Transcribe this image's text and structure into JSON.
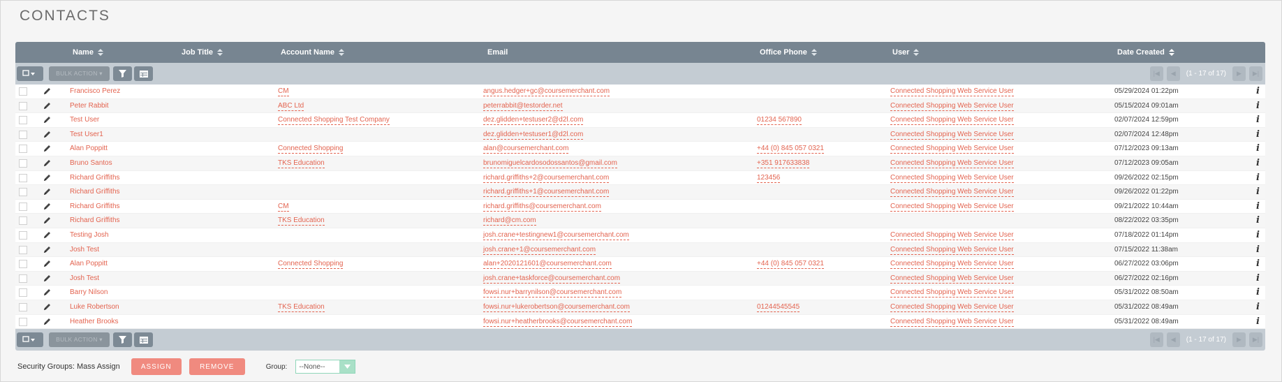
{
  "page": {
    "title": "CONTACTS"
  },
  "columns": {
    "name": "Name",
    "job_title": "Job Title",
    "account_name": "Account Name",
    "email": "Email",
    "office_phone": "Office Phone",
    "user": "User",
    "date_created": "Date Created"
  },
  "toolbar": {
    "bulk_action_label": "BULK ACTION ▾",
    "pagination_text": "(1 - 17 of 17)"
  },
  "rows": [
    {
      "name": "Francisco Perez",
      "account": "CM",
      "email": "angus.hedger+gc@coursemerchant.com",
      "phone": "",
      "user": "Connected Shopping Web Service User",
      "date": "05/29/2024 01:22pm"
    },
    {
      "name": "Peter Rabbit",
      "account": "ABC Ltd",
      "email": "peterrabbit@testorder.net",
      "phone": "",
      "user": "Connected Shopping Web Service User",
      "date": "05/15/2024 09:01am"
    },
    {
      "name": "Test User",
      "account": "Connected Shopping Test Company",
      "email": "dez.glidden+testuser2@d2l.com",
      "phone": "01234 567890",
      "user": "Connected Shopping Web Service User",
      "date": "02/07/2024 12:59pm"
    },
    {
      "name": "Test User1",
      "account": "",
      "email": "dez.glidden+testuser1@d2l.com",
      "phone": "",
      "user": "Connected Shopping Web Service User",
      "date": "02/07/2024 12:48pm"
    },
    {
      "name": "Alan Poppitt",
      "account": "Connected Shopping",
      "email": "alan@coursemerchant.com",
      "phone": "+44 (0) 845 057 0321",
      "user": "Connected Shopping Web Service User",
      "date": "07/12/2023 09:13am"
    },
    {
      "name": "Bruno Santos",
      "account": "TKS Education",
      "email": "brunomiguelcardosodossantos@gmail.com",
      "phone": "+351 917633838",
      "user": "Connected Shopping Web Service User",
      "date": "07/12/2023 09:05am"
    },
    {
      "name": "Richard Griffiths",
      "account": "",
      "email": "richard.griffiths+2@coursemerchant.com",
      "phone": "123456",
      "user": "Connected Shopping Web Service User",
      "date": "09/26/2022 02:15pm"
    },
    {
      "name": "Richard Griffiths",
      "account": "",
      "email": "richard.griffiths+1@coursemerchant.com",
      "phone": "",
      "user": "Connected Shopping Web Service User",
      "date": "09/26/2022 01:22pm"
    },
    {
      "name": "Richard Griffiths",
      "account": "CM",
      "email": "richard.griffiths@coursemerchant.com",
      "phone": "",
      "user": "Connected Shopping Web Service User",
      "date": "09/21/2022 10:44am"
    },
    {
      "name": "Richard Griffiths",
      "account": "TKS Education",
      "email": "richard@cm.com",
      "phone": "",
      "user": "",
      "date": "08/22/2022 03:35pm"
    },
    {
      "name": "Testing Josh",
      "account": "",
      "email": "josh.crane+testingnew1@coursemerchant.com",
      "phone": "",
      "user": "Connected Shopping Web Service User",
      "date": "07/18/2022 01:14pm"
    },
    {
      "name": "Josh Test",
      "account": "",
      "email": "josh.crane+1@coursemerchant.com",
      "phone": "",
      "user": "Connected Shopping Web Service User",
      "date": "07/15/2022 11:38am"
    },
    {
      "name": "Alan Poppitt",
      "account": "Connected Shopping",
      "email": "alan+2020121601@coursemerchant.com",
      "phone": "+44 (0) 845 057 0321",
      "user": "Connected Shopping Web Service User",
      "date": "06/27/2022 03:06pm"
    },
    {
      "name": "Josh Test",
      "account": "",
      "email": "josh.crane+taskforce@coursemerchant.com",
      "phone": "",
      "user": "Connected Shopping Web Service User",
      "date": "06/27/2022 02:16pm"
    },
    {
      "name": "Barry Nilson",
      "account": "",
      "email": "fowsi.nur+barrynilson@coursemerchant.com",
      "phone": "",
      "user": "Connected Shopping Web Service User",
      "date": "05/31/2022 08:50am"
    },
    {
      "name": "Luke Robertson",
      "account": "TKS Education",
      "email": "fowsi.nur+lukerobertson@coursemerchant.com",
      "phone": "01244545545",
      "user": "Connected Shopping Web Service User",
      "date": "05/31/2022 08:49am"
    },
    {
      "name": "Heather Brooks",
      "account": "",
      "email": "fowsi.nur+heatherbrooks@coursemerchant.com",
      "phone": "",
      "user": "Connected Shopping Web Service User",
      "date": "05/31/2022 08:49am"
    }
  ],
  "mass_assign": {
    "label": "Security Groups: Mass Assign",
    "assign_label": "ASSIGN",
    "remove_label": "REMOVE",
    "group_label": "Group:",
    "group_value": "--None--"
  },
  "colors": {
    "header": "#778591",
    "toolbar": "#c4ccd3",
    "link": "#e3634f",
    "button": "#f08a7f"
  },
  "icons": {
    "row_edit": "pencil-icon",
    "row_info": "info-icon",
    "filter": "filter-icon",
    "columns": "columns-icon",
    "select": "checkbox-dropdown-icon",
    "sort": "sort-icon"
  }
}
